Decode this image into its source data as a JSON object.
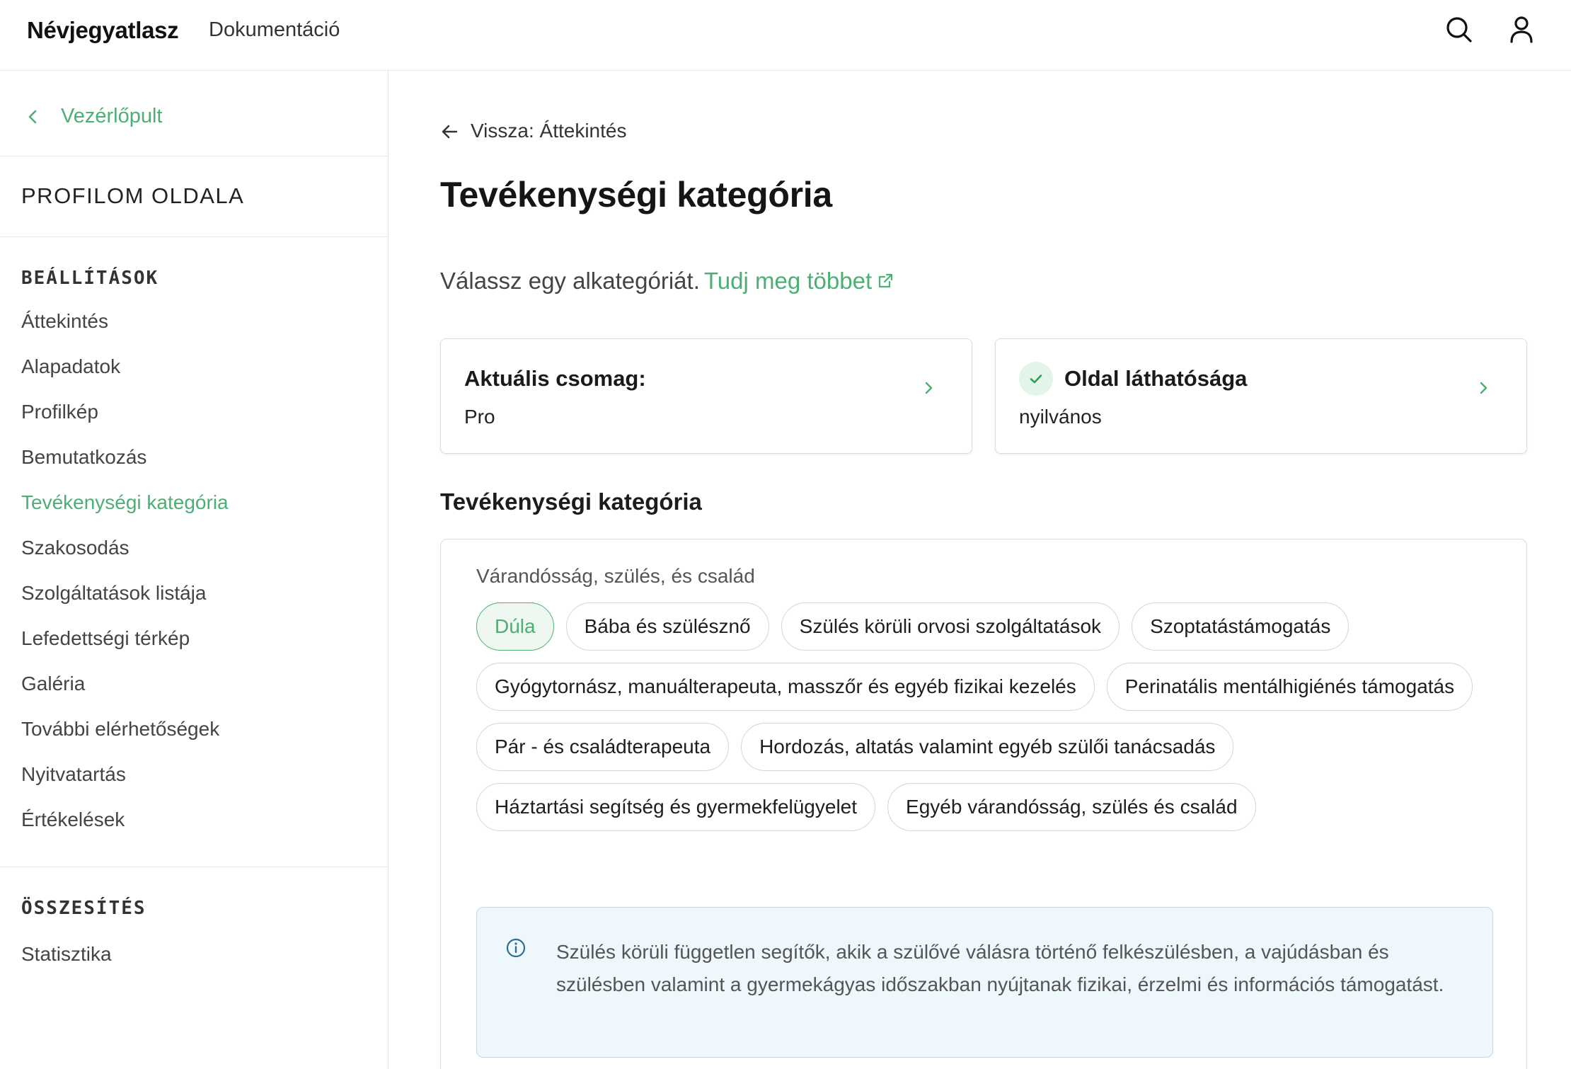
{
  "header": {
    "brand": "Névjegyatlasz",
    "docs_link": "Dokumentáció",
    "icons": [
      "search-icon",
      "user-icon"
    ]
  },
  "sidebar": {
    "back_label": "Vezérlőpult",
    "profile_label": "PROFILOM OLDALA",
    "settings_heading": "BEÁLLÍTÁSOK",
    "items": [
      "Áttekintés",
      "Alapadatok",
      "Profilkép",
      "Bemutatkozás",
      "Tevékenységi kategória",
      "Szakosodás",
      "Szolgáltatások listája",
      "Lefedettségi térkép",
      "Galéria",
      "További elérhetőségek",
      "Nyitvatartás",
      "Értékelések"
    ],
    "active_item": "Tevékenységi kategória",
    "summary_heading": "ÖSSZESÍTÉS",
    "summary_items": [
      "Statisztika"
    ]
  },
  "main": {
    "back_link": "Vissza: Áttekintés",
    "title": "Tevékenységi kategória",
    "intro": "Válassz egy alkategóriát.",
    "learn_more": "Tudj meg többet",
    "cards": {
      "package_title": "Aktuális csomag:",
      "package_value": "Pro",
      "visibility_title": "Oldal láthatósága",
      "visibility_value": "nyilvános"
    },
    "section_title": "Tevékenységi kategória",
    "group_label": "Várandósság, szülés, és család",
    "chips": [
      "Dúla",
      "Bába és szülésznő",
      "Szülés körüli orvosi szolgáltatások",
      "Szoptatástámogatás",
      "Gyógytornász, manuálterapeuta, masszőr és egyéb fizikai kezelés",
      "Perinatális mentálhigiénés támogatás",
      "Pár - és családterapeuta",
      "Hordozás, altatás valamint egyéb szülői tanácsadás",
      "Háztartási segítség és gyermekfelügyelet",
      "Egyéb várandósság, szülés és család"
    ],
    "selected_chip": "Dúla",
    "info_text": "Szülés körüli független segítők, akik a szülővé válásra történő felkészülésben, a vajúdásban és szülésben valamint a gyermekágyas időszakban nyújtanak fizikai, érzelmi és információs támogatást."
  },
  "colors": {
    "accent": "#4caf73",
    "info_bg": "#eef7fb",
    "info_border": "#b9dbe8",
    "border": "#dcdcdc"
  }
}
